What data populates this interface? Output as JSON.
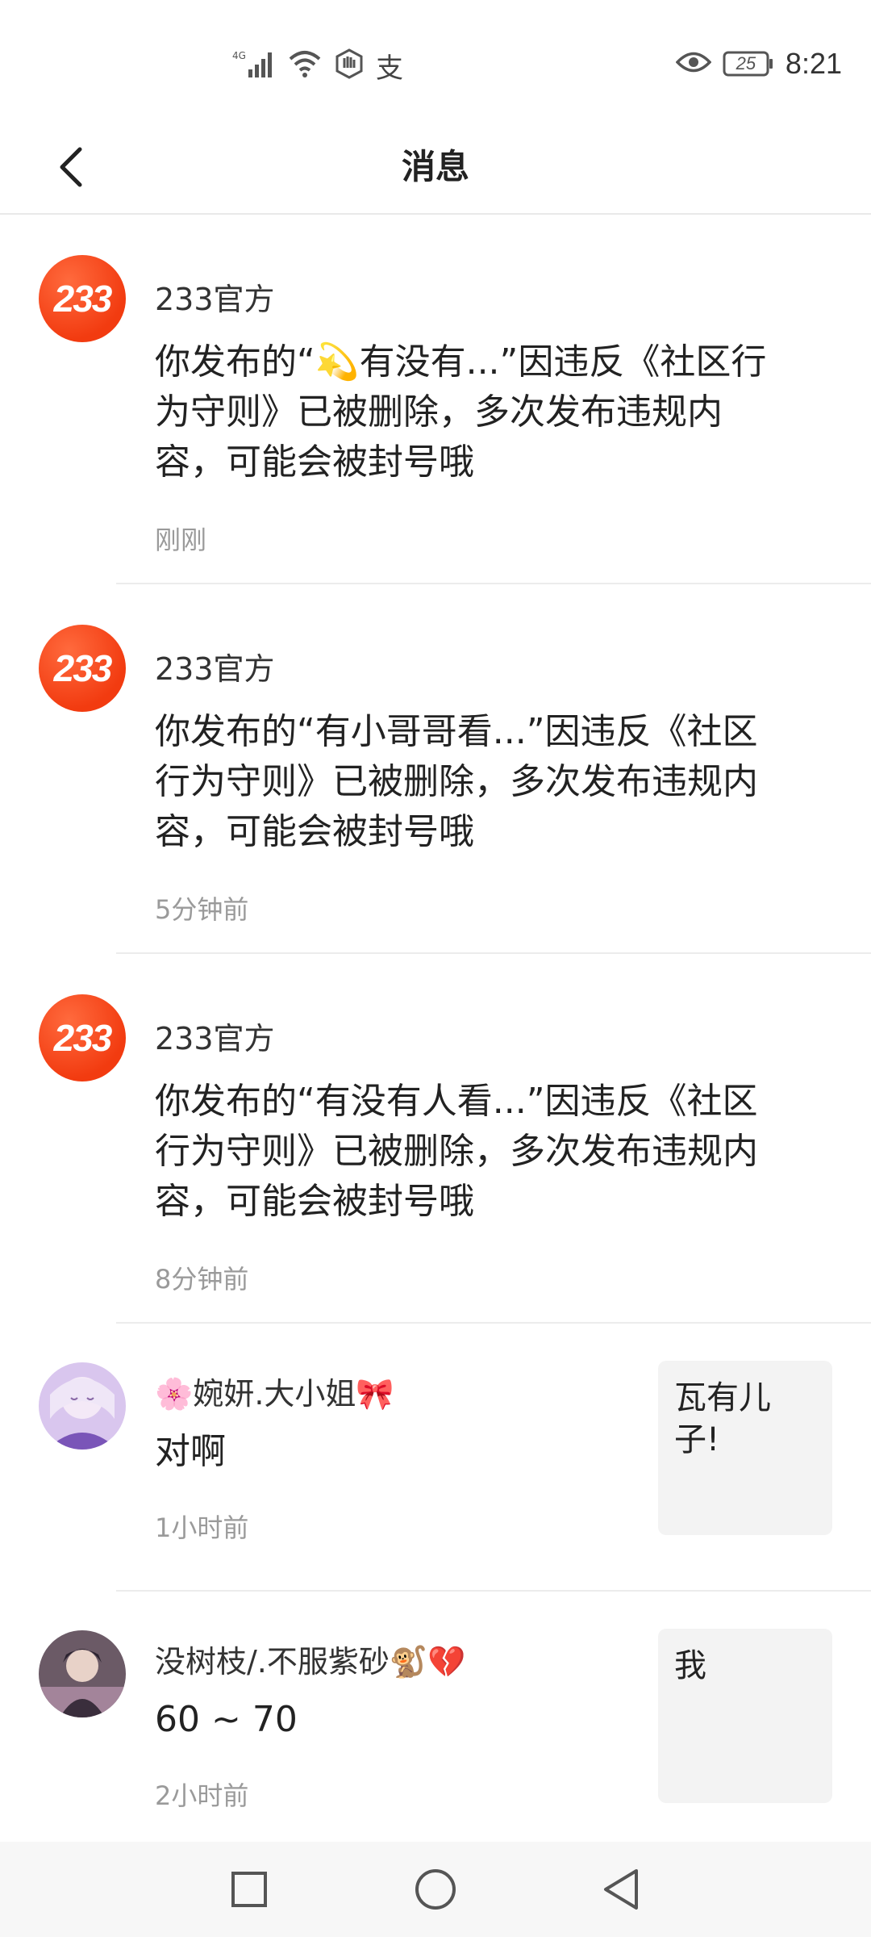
{
  "status_bar": {
    "network_label": "4G",
    "pay_label": "支",
    "battery_level": "25",
    "time": "8:21"
  },
  "header": {
    "title": "消息"
  },
  "messages": [
    {
      "sender": "233官方",
      "avatar_text": "233",
      "content": "你发布的“💫有没有...”因违反《社区行为守则》已被删除，多次发布违规内容，可能会被封号哦",
      "time": "刚刚"
    },
    {
      "sender": "233官方",
      "avatar_text": "233",
      "content": "你发布的“有小哥哥看...”因违反《社区行为守则》已被删除，多次发布违规内容，可能会被封号哦",
      "time": "5分钟前"
    },
    {
      "sender": "233官方",
      "avatar_text": "233",
      "content": "你发布的“有没有人看...”因违反《社区行为守则》已被删除，多次发布违规内容，可能会被封号哦",
      "time": "8分钟前"
    },
    {
      "sender": "🌸婉妍.大小姐🎀",
      "content": "对啊",
      "time": "1小时前",
      "quote": "瓦有儿子!"
    },
    {
      "sender": "没树枝/.不服紫砂🐒💔",
      "content": "60 ~ 70",
      "time": "2小时前",
      "quote": "我"
    }
  ],
  "colors": {
    "brand_orange": "#f23b10",
    "divider": "#ececec",
    "time_gray": "#9a9a9a",
    "quote_bg": "#f3f3f3"
  }
}
